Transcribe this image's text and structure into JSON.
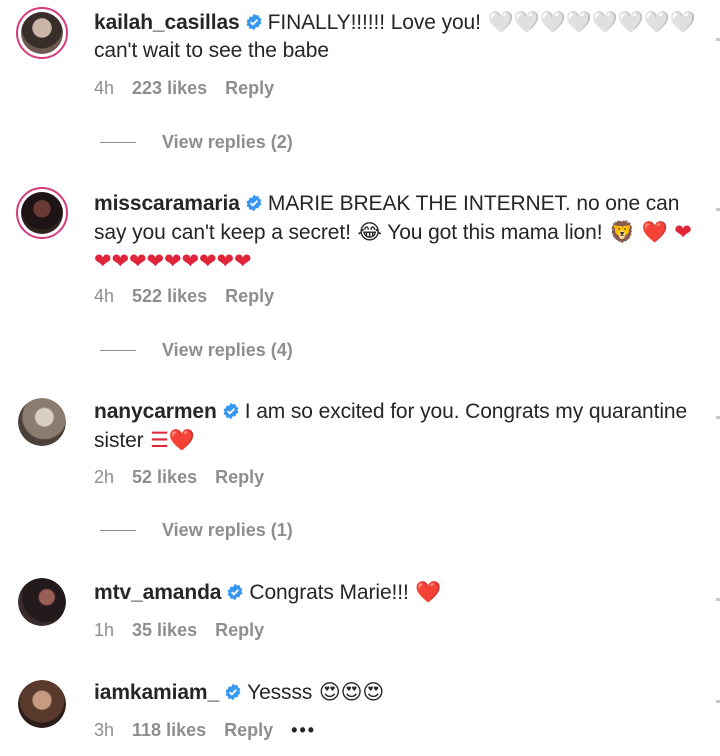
{
  "comments": [
    {
      "username": "kailah_casillas",
      "text_before": "FINALLY!!!!!! Love you!",
      "emoji": " 🤍🤍🤍🤍🤍🤍🤍🤍",
      "text_after": " can't wait to see the babe",
      "time": "4h",
      "likes": "223 likes",
      "reply": "Reply",
      "view_replies": "View replies (2)"
    },
    {
      "username": "misscaramaria",
      "text_before": "MARIE BREAK THE INTERNET. no one can say you can't keep a secret!",
      "emoji_laugh": " 😂",
      "text_mid": " You got this mama lion!",
      "emoji_lion": " 🦁",
      "emoji_hearts": " ❤️ ❤❤❤❤❤❤❤❤❤❤",
      "time": "4h",
      "likes": "522 likes",
      "reply": "Reply",
      "view_replies": "View replies (4)"
    },
    {
      "username": "nanycarmen",
      "text_before": "I am so excited for you. Congrats my quarantine sister",
      "emoji": " ☰❤️",
      "time": "2h",
      "likes": "52 likes",
      "reply": "Reply",
      "view_replies": "View replies (1)"
    },
    {
      "username": "mtv_amanda",
      "text_before": "Congrats Marie!!!",
      "emoji": " ❤️",
      "time": "1h",
      "likes": "35 likes",
      "reply": "Reply"
    },
    {
      "username": "iamkamiam_",
      "text_before": "Yessss",
      "emoji": " 😍😍😍",
      "time": "3h",
      "likes": "118 likes",
      "reply": "Reply",
      "more": "•••"
    }
  ],
  "colors": {
    "verified": "#3897f0",
    "muted": "#8e8e8e",
    "text": "#262626",
    "story_ring": "#d63b7e"
  }
}
